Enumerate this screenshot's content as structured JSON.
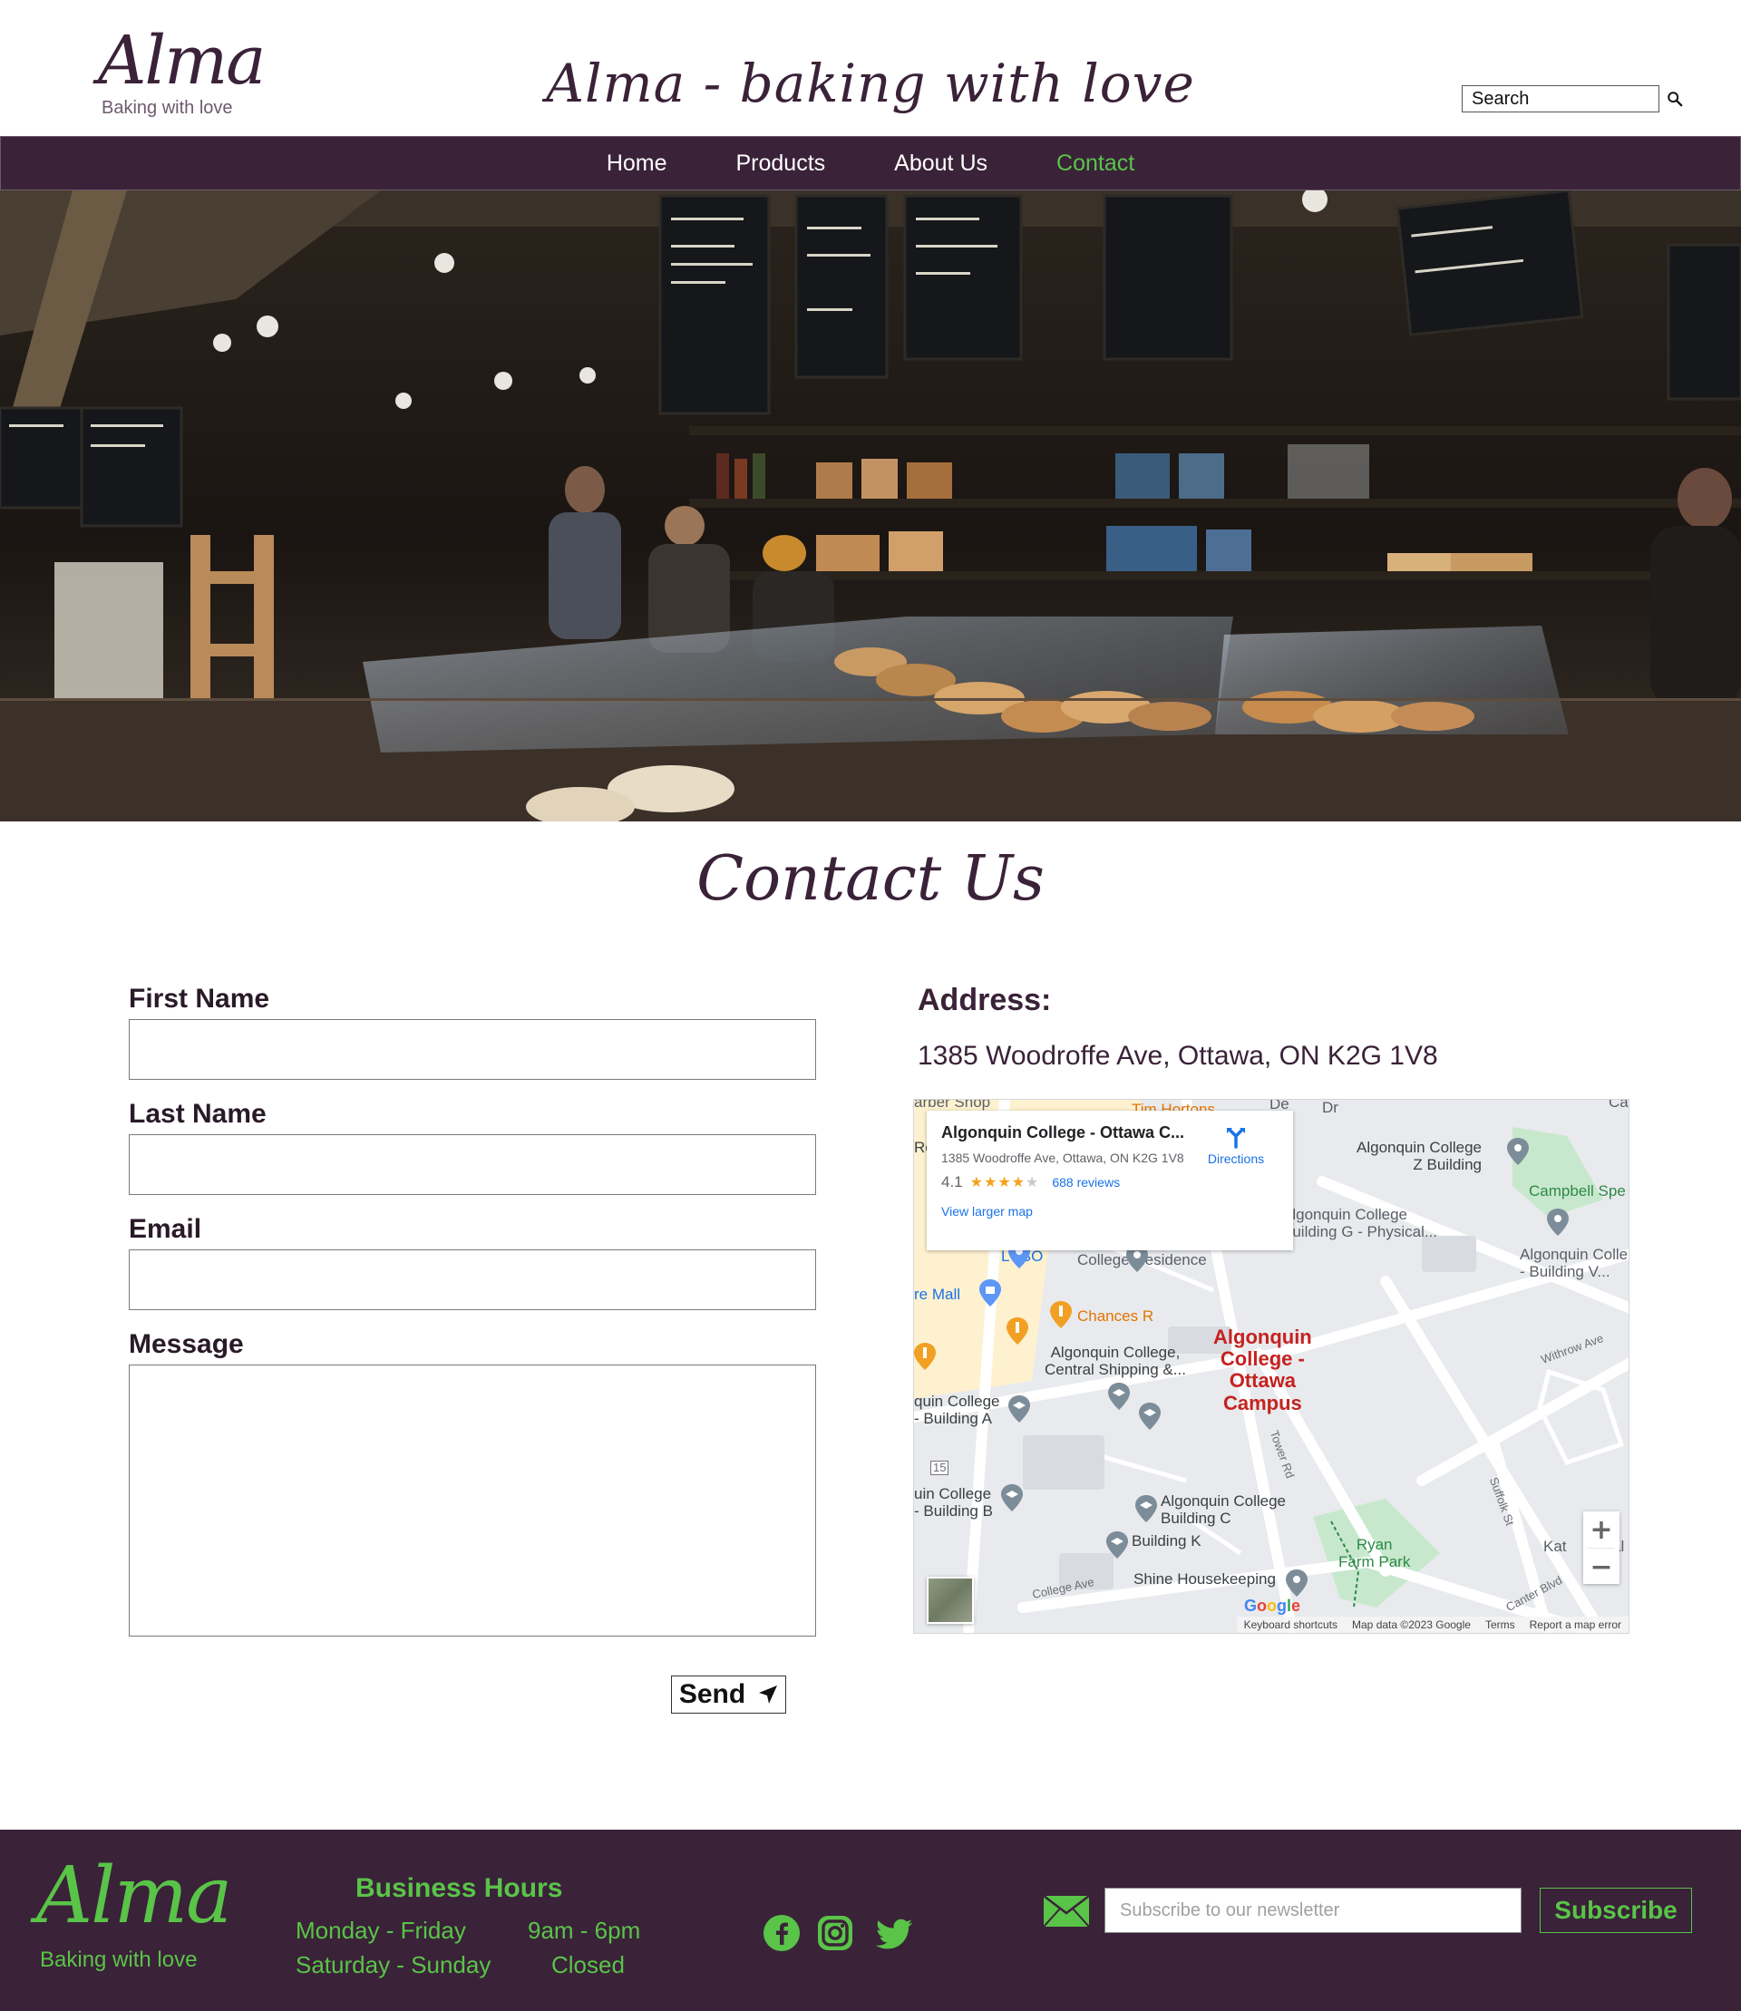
{
  "header": {
    "logo_text": "Alma",
    "logo_tagline": "Baking with love",
    "site_title": "Alma - baking with love",
    "search_placeholder": "Search"
  },
  "nav": {
    "items": [
      {
        "label": "Home"
      },
      {
        "label": "Products"
      },
      {
        "label": "About Us"
      },
      {
        "label": "Contact"
      }
    ],
    "active": "Contact"
  },
  "contact": {
    "title": "Contact Us",
    "form": {
      "first_name_label": "First Name",
      "last_name_label": "Last Name",
      "email_label": "Email",
      "message_label": "Message",
      "send_label": "Send"
    },
    "address_heading": "Address:",
    "address_text": "1385 Woodroffe Ave, Ottawa, ON K2G 1V8"
  },
  "map": {
    "card": {
      "title": "Algonquin College - Ottawa C...",
      "address": "1385 Woodroffe Ave, Ottawa, ON K2G 1V8",
      "rating": "4.1",
      "reviews": "688 reviews",
      "larger_map": "View larger map",
      "directions": "Directions"
    },
    "labels": {
      "barber": "arber Shop",
      "tim": "Tim Hortons",
      "ro": "Ro",
      "de": "De",
      "dr": "Dr",
      "ca": "Ca",
      "z_building": "Algonquin College\nZ Building",
      "campbell": "Campbell Spe",
      "building_g": "Algonquin College\nBuilding G - Physical...",
      "building_v": "Algonquin Colle\n- Building V...",
      "lcbo": "LCBO",
      "residence": "College Residence",
      "mall": "re Mall",
      "chances": "Chances R",
      "central_shipping": "Algonquin College,\nCentral Shipping &...",
      "campus": "Algonquin\nCollege -\nOttawa\nCampus",
      "withrow": "Withrow Ave",
      "building_a": "quin College\n- Building A",
      "tower": "Tower Rd",
      "route": "15",
      "building_b": "uin College\n- Building B",
      "building_c": "Algonquin College\nBuilding C",
      "suffolk": "Suffolk St",
      "building_k": "Building K",
      "ryan": "Ryan\nFarm Park",
      "kat": "Kat",
      "al": "al",
      "college_ave": "College Ave",
      "shine": "Shine Housekeeping",
      "canter": "Canter Blvd"
    },
    "google": "Google",
    "footer": {
      "shortcuts": "Keyboard shortcuts",
      "data": "Map data ©2023 Google",
      "terms": "Terms",
      "report": "Report a map error"
    },
    "zoom_in": "+",
    "zoom_out": "−"
  },
  "footer": {
    "logo_text": "Alma",
    "logo_tagline": "Baking with love",
    "hours_title": "Business Hours",
    "hours": [
      {
        "days": "Monday - Friday",
        "time": "9am - 6pm"
      },
      {
        "days": "Saturday - Sunday",
        "time": "Closed"
      }
    ],
    "social": [
      "facebook-icon",
      "instagram-icon",
      "twitter-icon"
    ],
    "newsletter_placeholder": "Subscribe to our newsletter",
    "subscribe_label": "Subscribe"
  },
  "colors": {
    "brand": "#3a2238",
    "accent": "#59c448",
    "map_red": "#c5221f",
    "map_blue": "#1a73e8"
  }
}
